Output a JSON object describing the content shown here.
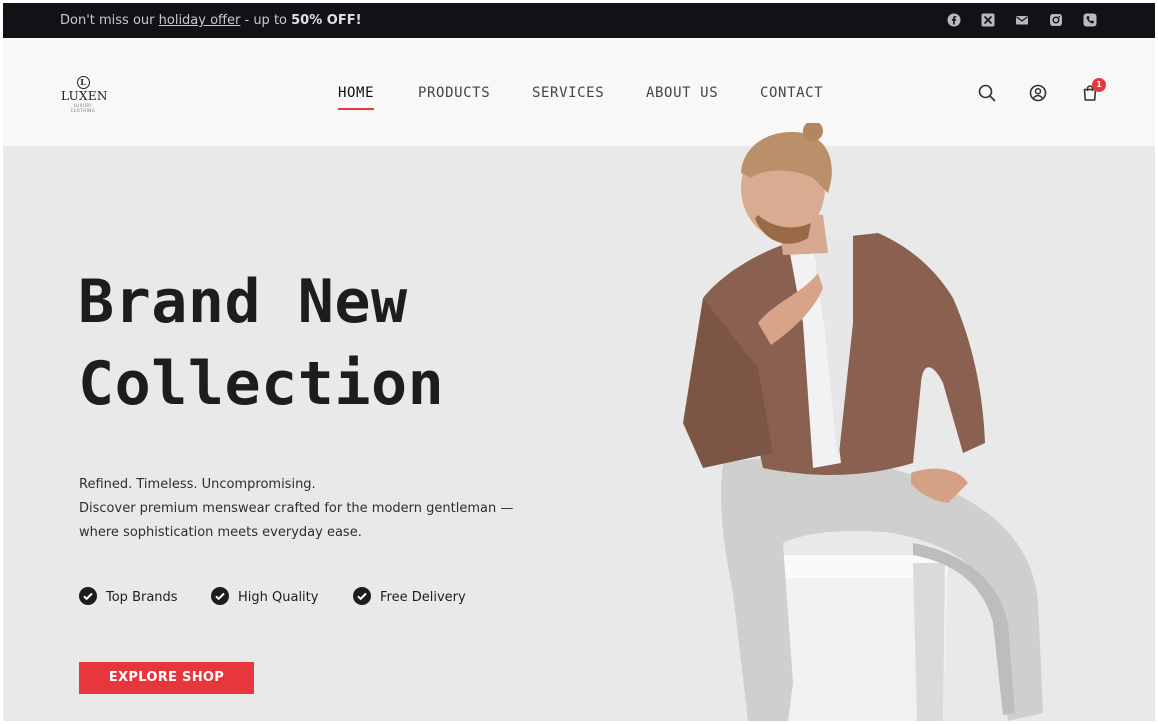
{
  "announcement": {
    "prefix": "Don't miss our ",
    "link_text": "holiday offer",
    "middle": " - up to ",
    "highlight": "50% OFF!"
  },
  "social_icons": [
    "facebook-icon",
    "x-icon",
    "mail-icon",
    "instagram-icon",
    "phone-icon"
  ],
  "brand": {
    "mark": "L",
    "name": "LUXEN",
    "tagline": "LUXURY CLOTHING"
  },
  "nav": {
    "items": [
      {
        "label": "HOME",
        "active": true
      },
      {
        "label": "PRODUCTS",
        "active": false
      },
      {
        "label": "SERVICES",
        "active": false
      },
      {
        "label": "ABOUT US",
        "active": false
      },
      {
        "label": "CONTACT",
        "active": false
      }
    ]
  },
  "header_icons": {
    "search": "search-icon",
    "account": "user-icon",
    "cart": "cart-icon",
    "cart_count": "1"
  },
  "hero": {
    "title_line1": "Brand New",
    "title_line2": "Collection",
    "desc_line1": "Refined. Timeless. Uncompromising.",
    "desc_line2": "Discover premium menswear crafted for the modern gentleman —",
    "desc_line3": "where sophistication meets everyday ease.",
    "features": [
      "Top Brands",
      "High Quality",
      "Free Delivery"
    ],
    "cta_label": "EXPLORE SHOP"
  },
  "colors": {
    "accent": "#e8363d",
    "topbar": "#131116",
    "header": "#f8f8f9",
    "hero_bg": "#e9e9e9",
    "text": "#1d1d1d"
  }
}
